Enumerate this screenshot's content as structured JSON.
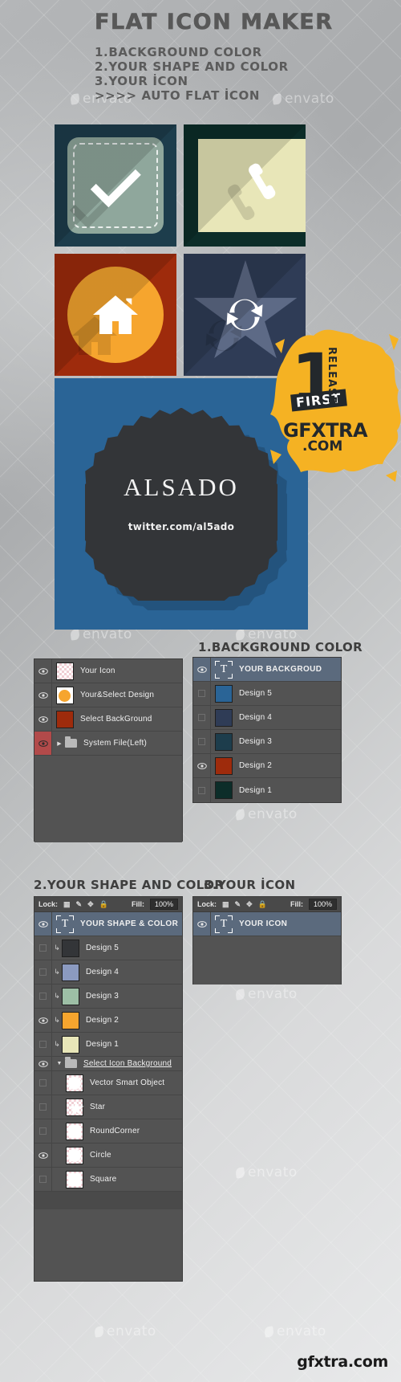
{
  "header": {
    "title": "FLAT ICON MAKER",
    "steps": [
      "1.BACKGROUND COLOR",
      "2.YOUR SHAPE AND COLOR",
      "3.YOUR İCON",
      ">>>> AUTO FLAT İCON"
    ]
  },
  "preview": {
    "tiles": [
      {
        "name": "check-tile",
        "bg": "#1d3d4c",
        "shape": "roundcorner",
        "shape_color": "#8fa79c",
        "icon": "check-icon"
      },
      {
        "name": "phone-tile",
        "bg": "#0c2d29",
        "shape": "square",
        "shape_color": "#e8e6b8",
        "icon": "phone-icon"
      },
      {
        "name": "home-tile",
        "bg": "#9e2b0c",
        "shape": "circle",
        "shape_color": "#f6a52e",
        "icon": "home-icon"
      },
      {
        "name": "refresh-tile",
        "bg": "#2f3c56",
        "shape": "star",
        "shape_color": "#5d6a86",
        "icon": "refresh-icon"
      }
    ]
  },
  "showcase": {
    "bg_color": "#2a6496",
    "badge_color": "#333538",
    "brand": "ALSADO",
    "handle": "twitter.com/al5ado"
  },
  "splat": {
    "number": "1",
    "first": "FIRST",
    "release": "RELEASE",
    "gfx": "GFXTRA",
    "dotcom": ".COM"
  },
  "panels": {
    "left_top": {
      "rows": [
        {
          "label": "Your Icon",
          "visible": true,
          "thumb": "checker",
          "thumb_color": "",
          "kind": "smart"
        },
        {
          "label": "Your&Select Design",
          "visible": true,
          "thumb": "color",
          "thumb_color": "#f6a52e",
          "kind": "smart"
        },
        {
          "label": "Select BackGround",
          "visible": true,
          "thumb": "color",
          "thumb_color": "#9e2b0c",
          "kind": "smart"
        },
        {
          "label": "System File(Left)",
          "visible": true,
          "thumb": "folder",
          "thumb_color": "",
          "kind": "group",
          "eye_highlight": true
        }
      ]
    },
    "background_color": {
      "heading": "1.BACKGROUND COLOR",
      "rows": [
        {
          "label": "YOUR BACKGROUD",
          "visible": true,
          "thumb": "text",
          "thumb_color": "",
          "selected": true
        },
        {
          "label": "Design 5",
          "visible": false,
          "thumb": "color",
          "thumb_color": "#2a6496"
        },
        {
          "label": "Design 4",
          "visible": false,
          "thumb": "color",
          "thumb_color": "#2f3c56"
        },
        {
          "label": "Design 3",
          "visible": false,
          "thumb": "color",
          "thumb_color": "#1d3d4c"
        },
        {
          "label": "Design 2",
          "visible": true,
          "thumb": "color",
          "thumb_color": "#9e2b0c"
        },
        {
          "label": "Design 1",
          "visible": false,
          "thumb": "color",
          "thumb_color": "#0c2d29"
        }
      ]
    },
    "shape_and_color": {
      "heading": "2.YOUR SHAPE AND COLOR",
      "lock_label": "Lock:",
      "fill_label": "Fill:",
      "fill_value": "100%",
      "lock_icons": [
        "lock-transparency-icon",
        "lock-brush-icon",
        "lock-move-icon",
        "lock-all-icon"
      ],
      "rows": [
        {
          "label": "YOUR SHAPE & COLOR",
          "visible": true,
          "thumb": "text",
          "thumb_color": "",
          "selected": true
        },
        {
          "label": "Design 5",
          "visible": false,
          "thumb": "color",
          "thumb_color": "#333538",
          "clipped": true
        },
        {
          "label": "Design 4",
          "visible": false,
          "thumb": "color",
          "thumb_color": "#8b9ac0",
          "clipped": true
        },
        {
          "label": "Design 3",
          "visible": false,
          "thumb": "color",
          "thumb_color": "#9dbfa6",
          "clipped": true
        },
        {
          "label": "Design 2",
          "visible": true,
          "thumb": "color",
          "thumb_color": "#f6a52e",
          "clipped": true
        },
        {
          "label": "Design 1",
          "visible": false,
          "thumb": "color",
          "thumb_color": "#e8e6b8",
          "clipped": true
        },
        {
          "label": "Select Icon Background",
          "visible": true,
          "thumb": "folder",
          "thumb_color": "",
          "kind": "group"
        },
        {
          "label": "Vector Smart Object",
          "visible": false,
          "thumb": "circle",
          "thumb_color": ""
        },
        {
          "label": "Star",
          "visible": false,
          "thumb": "star",
          "thumb_color": ""
        },
        {
          "label": "RoundCorner",
          "visible": false,
          "thumb": "rc",
          "thumb_color": ""
        },
        {
          "label": "Circle",
          "visible": true,
          "thumb": "circle",
          "thumb_color": ""
        },
        {
          "label": "Square",
          "visible": false,
          "thumb": "square",
          "thumb_color": ""
        }
      ]
    },
    "your_icon": {
      "heading": "3.YOUR İCON",
      "lock_label": "Lock:",
      "fill_label": "Fill:",
      "fill_value": "100%",
      "rows": [
        {
          "label": "YOUR ICON",
          "visible": true,
          "thumb": "text",
          "thumb_color": "",
          "selected": true
        }
      ]
    }
  },
  "watermarks": {
    "envato": "envato",
    "footer": "gfxtra.com"
  }
}
